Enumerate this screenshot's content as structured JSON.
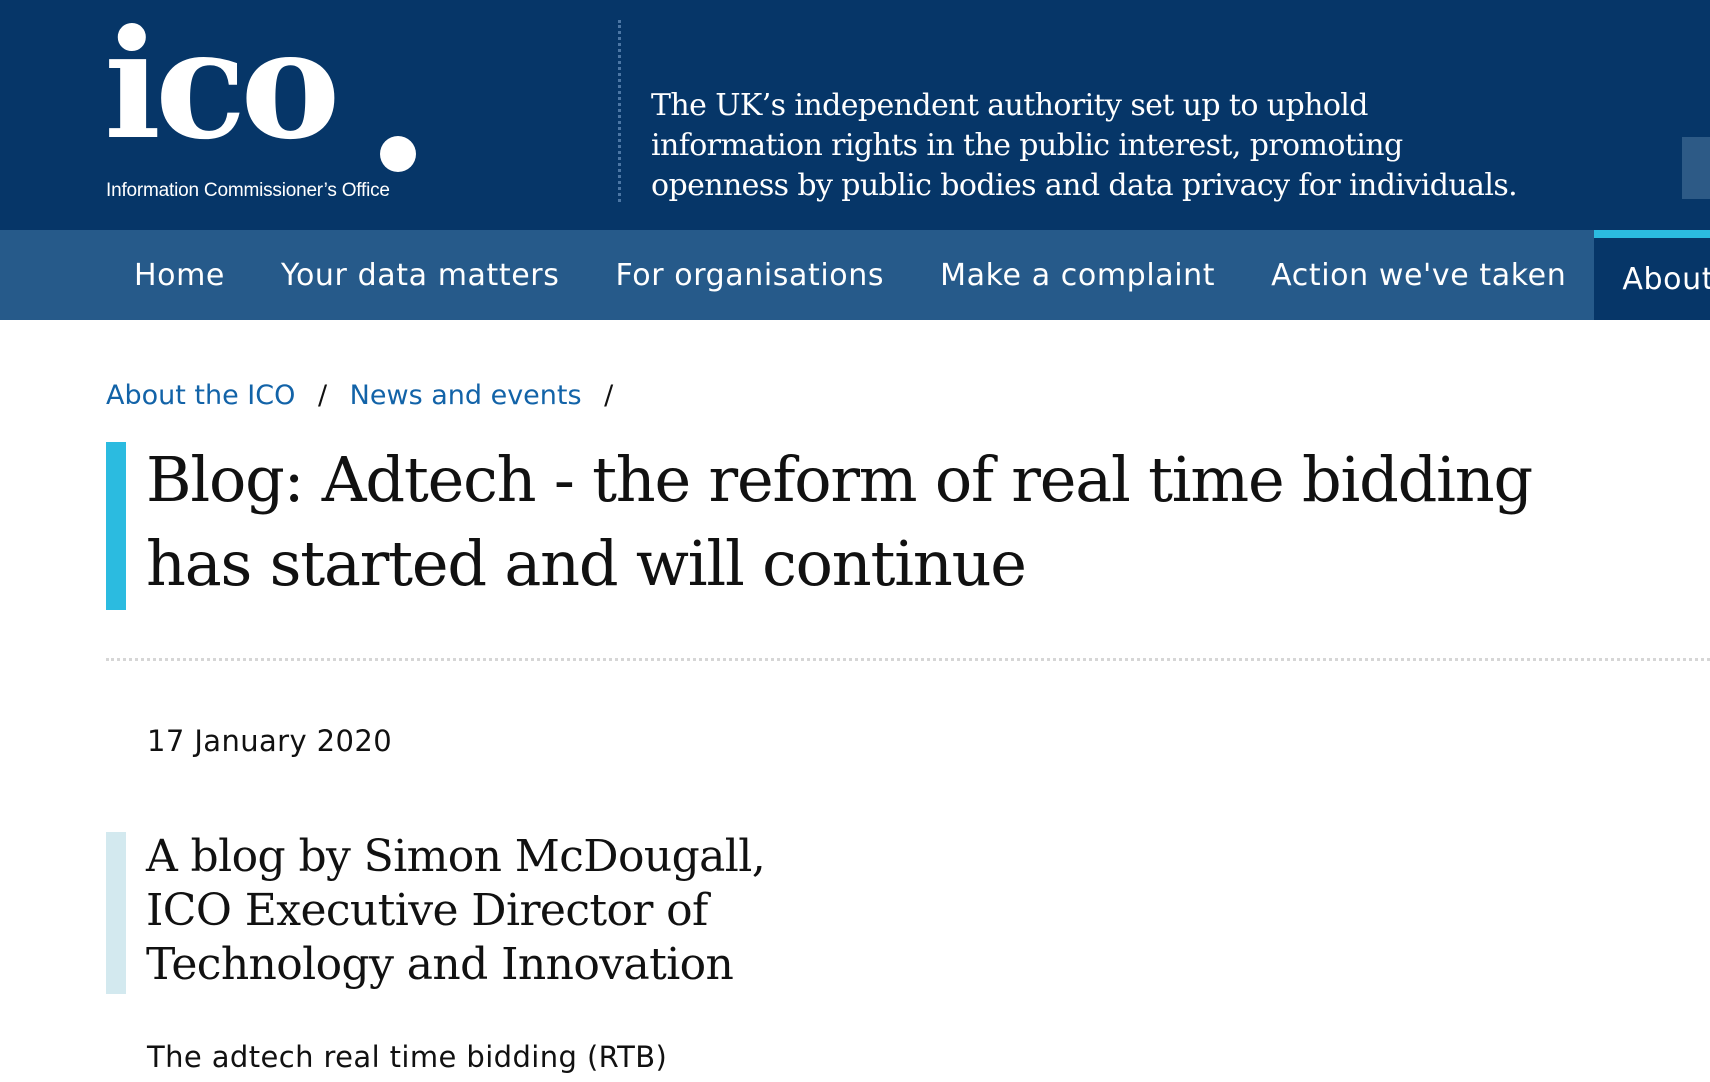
{
  "masthead": {
    "logo_mark": "ico",
    "logo_subtitle": "Information Commissioner’s Office",
    "tagline": "The UK’s independent authority set up to uphold information rights in the public interest, promoting openness by public bodies and data privacy for individuals."
  },
  "nav": {
    "items": [
      {
        "label": "Home"
      },
      {
        "label": "Your data matters"
      },
      {
        "label": "For organisations"
      },
      {
        "label": "Make a complaint"
      },
      {
        "label": "Action we've taken"
      },
      {
        "label": "About t"
      }
    ]
  },
  "breadcrumb": {
    "items": [
      {
        "label": "About the ICO"
      },
      {
        "label": "News and events"
      }
    ],
    "separator": "/"
  },
  "article": {
    "title": "Blog: Adtech - the reform of real time bidding has started and will continue",
    "date": "17 January 2020",
    "author_intro": "A blog by Simon McDougall, ICO Executive Director of Technology and Innovation",
    "body_start": "The adtech real time bidding (RTB)"
  },
  "colors": {
    "masthead_bg": "#063668",
    "nav_bg": "#265a8a",
    "accent": "#2bbbe0",
    "link": "#1263a8",
    "author_bar": "#d3e9ef"
  }
}
